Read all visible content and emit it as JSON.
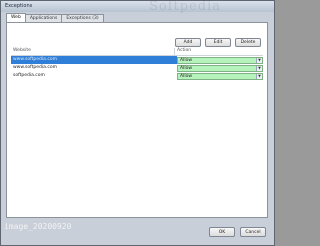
{
  "window": {
    "title": "Exceptions"
  },
  "watermark": {
    "top": "Softpedia",
    "bottom_line1": "image_20200920",
    "bottom_line2": ""
  },
  "tabs": [
    {
      "label": "Web"
    },
    {
      "label": "Applications"
    },
    {
      "label": "Exceptions (3)"
    }
  ],
  "toolbar": {
    "add_label": "Add",
    "edit_label": "Edit",
    "delete_label": "Delete"
  },
  "table": {
    "columns": [
      "Website",
      "Action"
    ],
    "rows": [
      {
        "site": "www.softpedia.com",
        "action": "Allow",
        "selected": true
      },
      {
        "site": "www.softpedia.com",
        "action": "Allow",
        "selected": false
      },
      {
        "site": "softpedia.com",
        "action": "Allow",
        "selected": false
      }
    ]
  },
  "footer": {
    "ok_label": "OK",
    "cancel_label": "Cancel"
  },
  "colors": {
    "selection": "#2f7fd8",
    "action_bg": "#b6f2bb"
  }
}
